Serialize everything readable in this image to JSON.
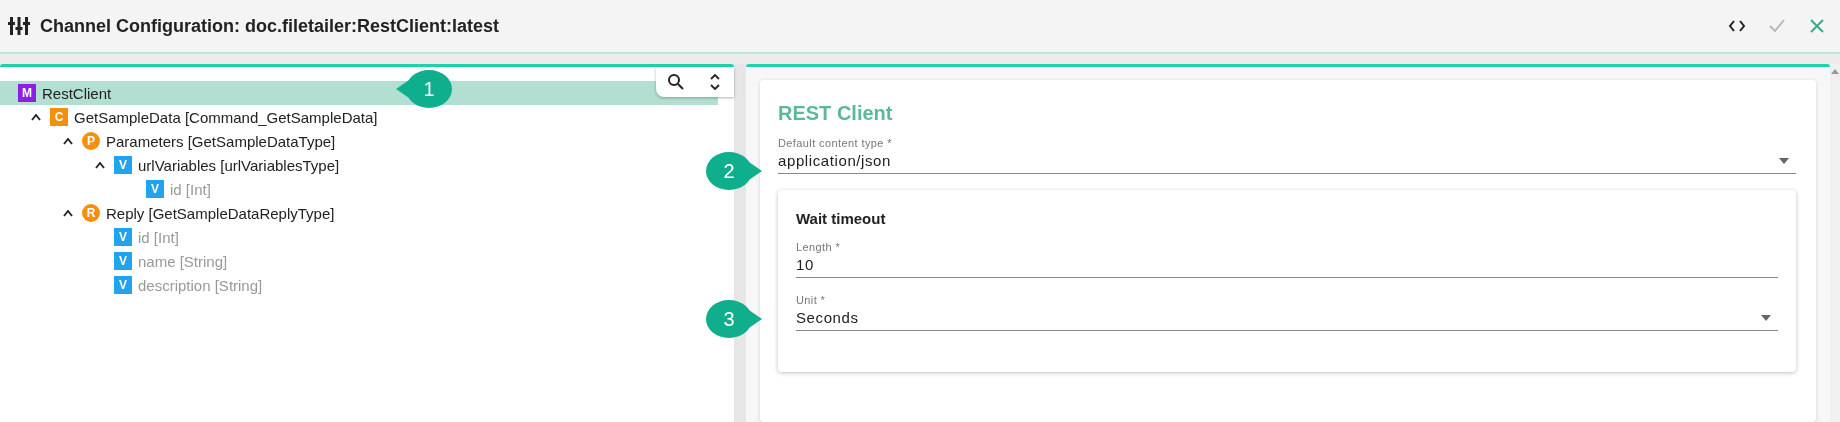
{
  "window": {
    "title": "Channel Configuration: doc.filetailer:RestClient:latest"
  },
  "header_actions": [
    {
      "kind": "code",
      "disabled": false
    },
    {
      "kind": "check",
      "disabled": true
    },
    {
      "kind": "close",
      "disabled": false
    }
  ],
  "tree": {
    "items": [
      {
        "label": "RestClient",
        "badge": "M",
        "kind": "square",
        "color": "#8f1fe0",
        "selected": true,
        "dimmed": false,
        "children": [
          {
            "label": "GetSampleData [Command_GetSampleData]",
            "badge": "C",
            "kind": "square",
            "color": "#f5900f",
            "selected": false,
            "dimmed": false,
            "expanded": true,
            "children": [
              {
                "label": "Parameters [GetSampleDataType]",
                "badge": "P",
                "kind": "circle",
                "color": "#f5900f",
                "selected": false,
                "dimmed": false,
                "expanded": true,
                "children": [
                  {
                    "label": "urlVariables [urlVariablesType]",
                    "badge": "V",
                    "kind": "square",
                    "color": "#21a3f0",
                    "selected": false,
                    "dimmed": false,
                    "expanded": true,
                    "children": [
                      {
                        "label": "id [Int]",
                        "badge": "V",
                        "kind": "square",
                        "color": "#21a3f0",
                        "selected": false,
                        "dimmed": true
                      }
                    ]
                  }
                ]
              },
              {
                "label": "Reply [GetSampleDataReplyType]",
                "badge": "R",
                "kind": "circle",
                "color": "#f5900f",
                "selected": false,
                "dimmed": false,
                "expanded": true,
                "children": [
                  {
                    "label": "id [Int]",
                    "badge": "V",
                    "kind": "square",
                    "color": "#21a3f0",
                    "selected": false,
                    "dimmed": true
                  },
                  {
                    "label": "name [String]",
                    "badge": "V",
                    "kind": "square",
                    "color": "#21a3f0",
                    "selected": false,
                    "dimmed": true
                  },
                  {
                    "label": "description [String]",
                    "badge": "V",
                    "kind": "square",
                    "color": "#21a3f0",
                    "selected": false,
                    "dimmed": true
                  }
                ]
              }
            ]
          }
        ]
      }
    ]
  },
  "form": {
    "title": "REST Client",
    "content_type": {
      "label": "Default content type *",
      "value": "application/json"
    },
    "wait_timeout": {
      "title": "Wait timeout",
      "length": {
        "label": "Length *",
        "value": "10"
      },
      "unit": {
        "label": "Unit *",
        "value": "Seconds"
      }
    }
  },
  "callouts": [
    {
      "label": "1"
    },
    {
      "label": "2"
    },
    {
      "label": "3"
    }
  ]
}
